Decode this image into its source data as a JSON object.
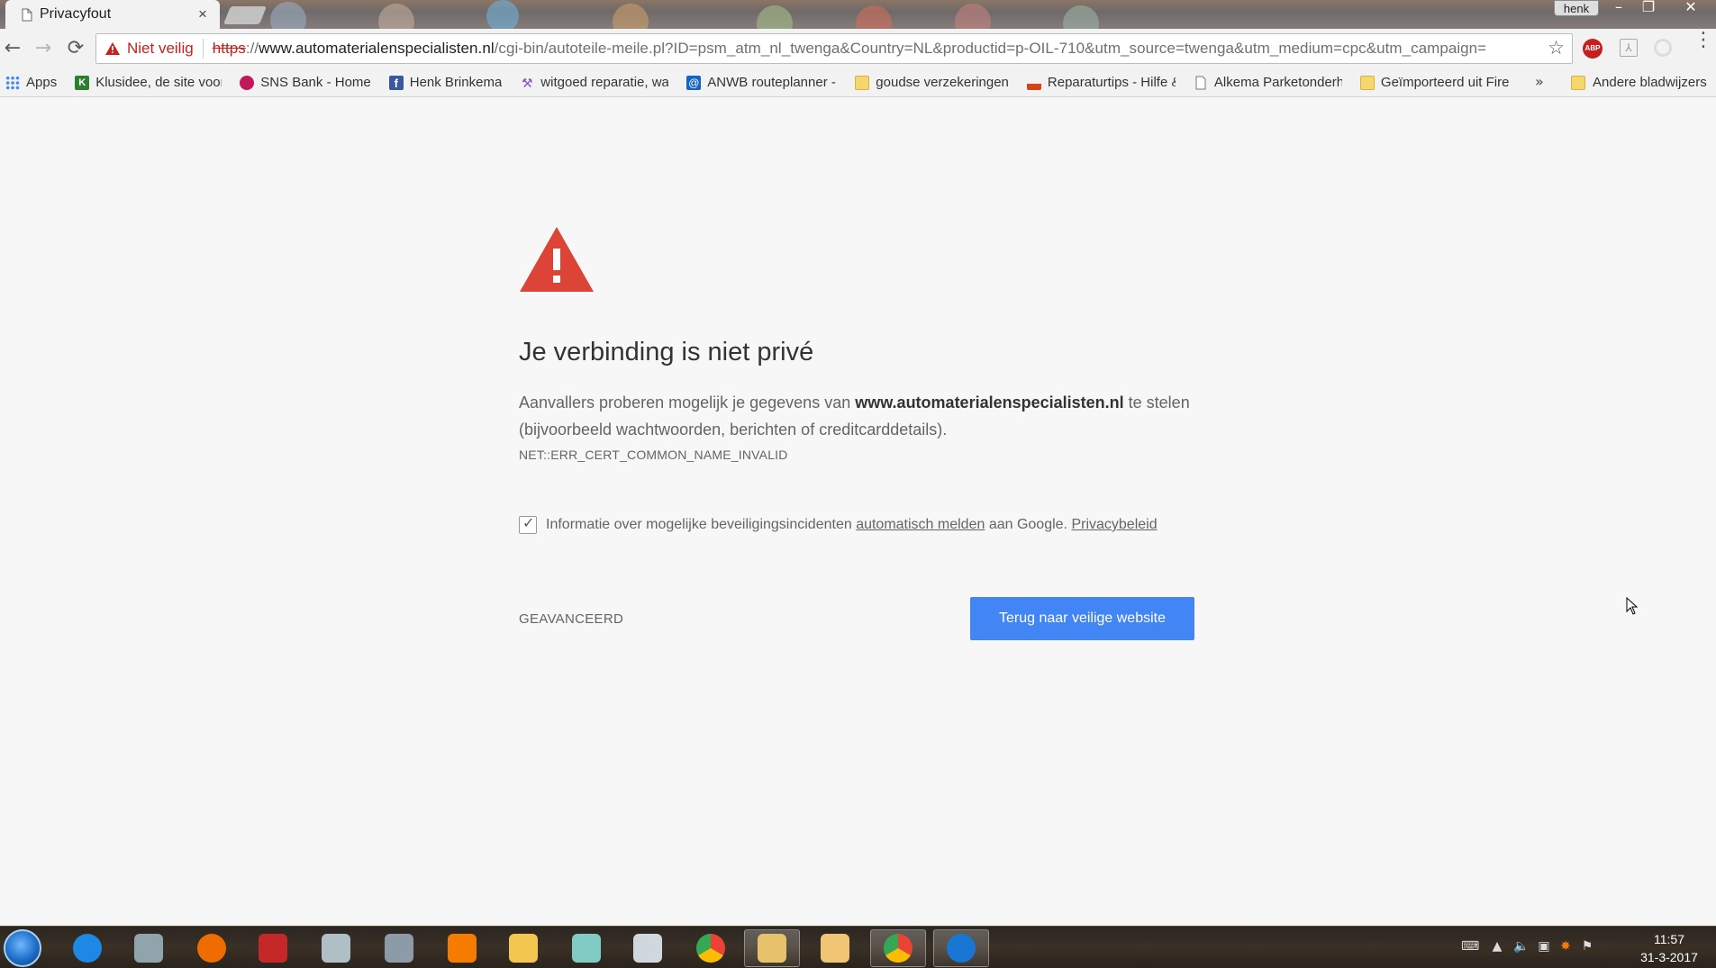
{
  "window": {
    "profile": "henk",
    "minimize": "–",
    "maximize": "❐",
    "close": "✕"
  },
  "tab": {
    "title": "Privacyfout",
    "close": "×"
  },
  "toolbar": {
    "back": "←",
    "forward": "→",
    "reload": "⟳",
    "security_label": "Niet veilig",
    "url_scheme": "https",
    "url_sep": "://",
    "url_host": "www.automaterialenspecialisten.nl",
    "url_rest": "/cgi-bin/autoteile-meile.pl?ID=psm_atm_nl_twenga&Country=NL&productid=p-OIL-710&utm_source=twenga&utm_medium=cpc&utm_campaign=",
    "star": "☆",
    "abp": "ABP",
    "menu": "⋮"
  },
  "bookmarks": {
    "items": [
      {
        "label": "Apps",
        "icon": "apps-grid-icon",
        "color": "#4285f4"
      },
      {
        "label": "Klusidee, de site voor",
        "icon": "klusidee-icon",
        "color": "#2e7d32"
      },
      {
        "label": "SNS Bank - Home",
        "icon": "sns-icon",
        "color": "#c2185b"
      },
      {
        "label": "Henk Brinkema",
        "icon": "facebook-icon",
        "color": "#3b5998"
      },
      {
        "label": "witgoed reparatie, wa",
        "icon": "tool-icon",
        "color": "#7e57c2"
      },
      {
        "label": "ANWB routeplanner -",
        "icon": "anwb-icon",
        "color": "#1565c0"
      },
      {
        "label": "goudse verzekeringen",
        "icon": "folder-icon",
        "color": "#f5d76e"
      },
      {
        "label": "Reparaturtips - Hilfe &",
        "icon": "repair-icon",
        "color": "#d84315"
      },
      {
        "label": "Alkema Parketonderh",
        "icon": "page-icon",
        "color": "#ffffff"
      },
      {
        "label": "Geïmporteerd uit Fire",
        "icon": "folder-icon",
        "color": "#f5d76e"
      }
    ],
    "more": "»",
    "other": "Andere bladwijzers"
  },
  "interstitial": {
    "heading": "Je verbinding is niet privé",
    "explanation_pre": "Aanvallers proberen mogelijk je gegevens van ",
    "explanation_host": "www.automaterialenspecialisten.nl",
    "explanation_post": " te stelen (bijvoorbeeld wachtwoorden, berichten of creditcarddetails).",
    "error_code": "NET::ERR_CERT_COMMON_NAME_INVALID",
    "checkbox_checked": true,
    "checkbox_check": "✓",
    "report_pre": "Informatie over mogelijke beveiligingsincidenten ",
    "report_link": "automatisch melden",
    "report_mid": " aan Google. ",
    "privacy_link": "Privacybeleid",
    "advanced": "GEAVANCEERD",
    "back_button": "Terug naar veilige website",
    "warning_color": "#db4437",
    "button_color": "#4285f4"
  },
  "taskbar": {
    "apps": [
      {
        "name": "internet-explorer",
        "color": "#1e88e5"
      },
      {
        "name": "computer",
        "color": "#90a4ae"
      },
      {
        "name": "firefox",
        "color": "#ef6c00"
      },
      {
        "name": "ccleaner",
        "color": "#c62828"
      },
      {
        "name": "xmind",
        "color": "#b0bec5"
      },
      {
        "name": "paint",
        "color": "#8d9aa8"
      },
      {
        "name": "avast",
        "color": "#f57c00"
      },
      {
        "name": "file-explorer",
        "color": "#f3c64f"
      },
      {
        "name": "notepad",
        "color": "#80cbc4"
      },
      {
        "name": "calculator",
        "color": "#cfd8dc"
      },
      {
        "name": "chrome",
        "color": "#34a853"
      },
      {
        "name": "outlook",
        "color": "#e8c26a"
      },
      {
        "name": "photo-viewer",
        "color": "#f0c674"
      },
      {
        "name": "chrome-profile",
        "color": "#ea4335"
      },
      {
        "name": "teamviewer",
        "color": "#1976d2"
      }
    ],
    "time": "11:57",
    "date": "31-3-2017"
  }
}
